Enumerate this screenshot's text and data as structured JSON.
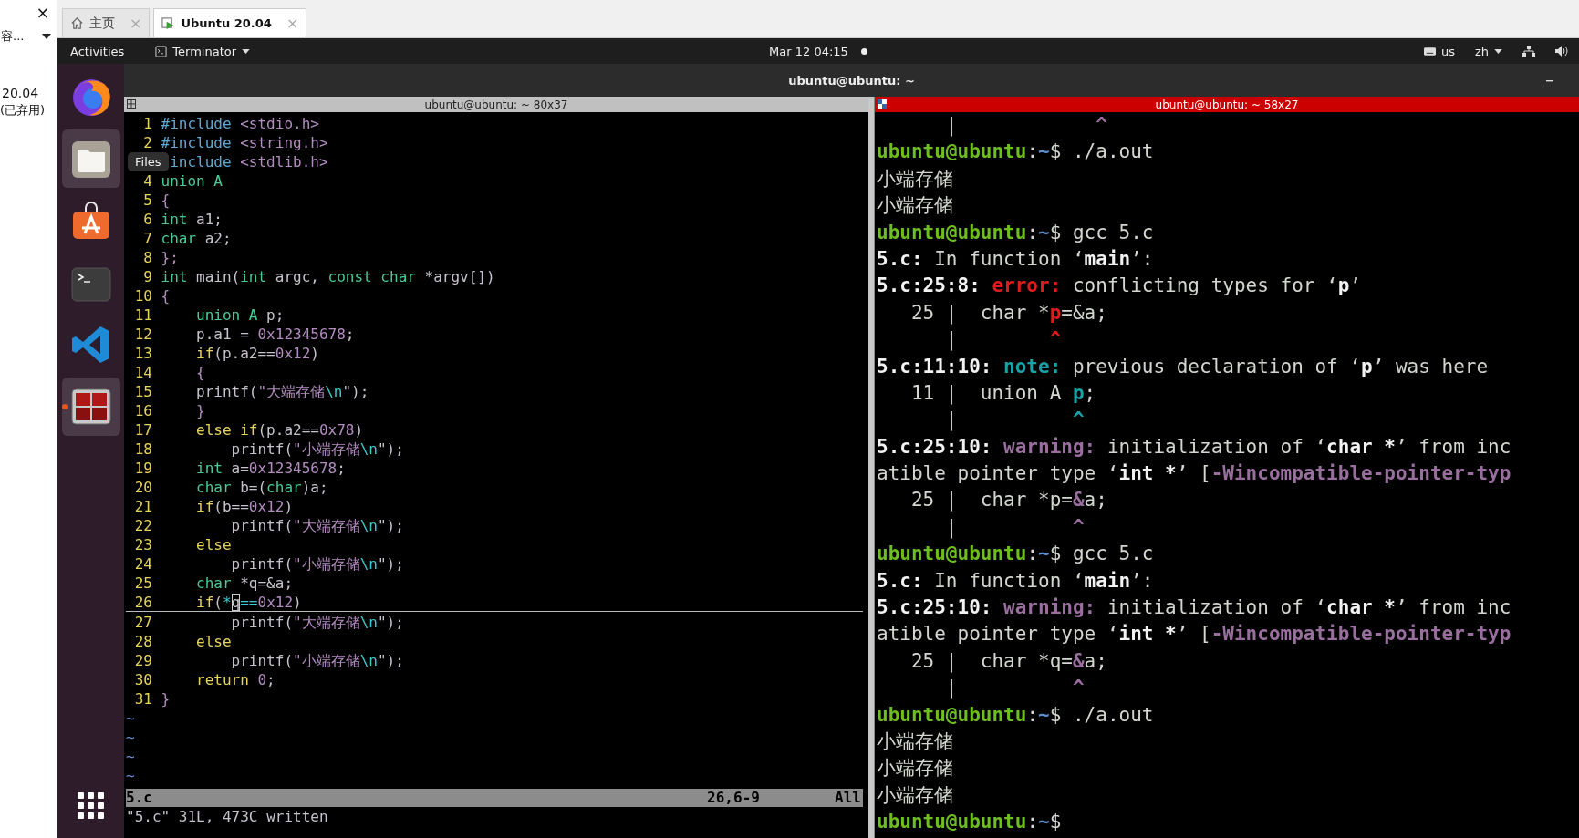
{
  "host": {
    "close": "×",
    "dropdown": "容...",
    "vm_version": "20.04",
    "vm_note": "(已弃用)",
    "tabs": [
      {
        "label": "主页",
        "kind": "home",
        "selected": false,
        "close": "×"
      },
      {
        "label": "Ubuntu 20.04",
        "kind": "vm",
        "selected": true,
        "close": "×"
      }
    ]
  },
  "topbar": {
    "activities": "Activities",
    "app_menu": "Terminator",
    "clock": "Mar 12 04:15",
    "keyboard": "us",
    "input_method": "zh"
  },
  "dock": {
    "tooltip": "Files",
    "items": [
      {
        "kind": "browser",
        "highlighted": false,
        "running": false
      },
      {
        "kind": "files",
        "highlighted": true,
        "running": false
      },
      {
        "kind": "software",
        "highlighted": false,
        "running": false
      },
      {
        "kind": "terminal",
        "highlighted": false,
        "running": false
      },
      {
        "kind": "editor",
        "highlighted": false,
        "running": false
      },
      {
        "kind": "terminator",
        "highlighted": true,
        "running": true
      }
    ]
  },
  "window": {
    "title": "ubuntu@ubuntu: ~"
  },
  "panes": [
    {
      "title": "ubuntu@ubuntu: ~ 80x37",
      "focused": false
    },
    {
      "title": "ubuntu@ubuntu: ~ 58x27",
      "focused": true
    }
  ],
  "vim": {
    "lines": [
      {
        "num": "1",
        "current": false,
        "segs": [
          {
            "text": "#include",
            "kind": "pre"
          },
          {
            "text": " <stdio.h>",
            "kind": "const"
          }
        ]
      },
      {
        "num": "2",
        "current": false,
        "segs": [
          {
            "text": "#include",
            "kind": "pre"
          },
          {
            "text": " <string.h>",
            "kind": "const"
          }
        ]
      },
      {
        "current": false,
        "segs": [
          {
            "text": "include",
            "kind": "pre"
          },
          {
            "text": " <stdlib.h>",
            "kind": "const"
          }
        ]
      },
      {
        "num": "4",
        "current": false,
        "segs": [
          {
            "text": "union A",
            "kind": "type"
          }
        ]
      },
      {
        "num": "5",
        "current": false,
        "segs": [
          {
            "text": "{",
            "kind": "const"
          }
        ]
      },
      {
        "num": "6",
        "current": false,
        "segs": [
          {
            "text": "int",
            "kind": "type"
          },
          {
            "text": " a1;",
            "kind": "plain"
          }
        ]
      },
      {
        "num": "7",
        "current": false,
        "segs": [
          {
            "text": "char",
            "kind": "type"
          },
          {
            "text": " a2;",
            "kind": "plain"
          }
        ]
      },
      {
        "num": "8",
        "current": false,
        "segs": [
          {
            "text": "};",
            "kind": "const"
          }
        ]
      },
      {
        "num": "9",
        "current": false,
        "segs": [
          {
            "text": "int",
            "kind": "type"
          },
          {
            "text": " main(",
            "kind": "plain"
          },
          {
            "text": "int",
            "kind": "type"
          },
          {
            "text": " argc, ",
            "kind": "plain"
          },
          {
            "text": "const",
            "kind": "type"
          },
          {
            "text": " char",
            "kind": "type"
          },
          {
            "text": " *argv[])",
            "kind": "plain"
          }
        ]
      },
      {
        "num": "10",
        "current": false,
        "segs": [
          {
            "text": "{",
            "kind": "const"
          }
        ]
      },
      {
        "num": "11",
        "current": false,
        "segs": [
          {
            "text": "    union A",
            "kind": "type"
          },
          {
            "text": " p;",
            "kind": "plain"
          }
        ]
      },
      {
        "num": "12",
        "current": false,
        "segs": [
          {
            "text": "    p.a1 = ",
            "kind": "plain"
          },
          {
            "text": "0x12345678",
            "kind": "const"
          },
          {
            "text": ";",
            "kind": "plain"
          }
        ]
      },
      {
        "num": "13",
        "current": false,
        "segs": [
          {
            "text": "    if",
            "kind": "stmt"
          },
          {
            "text": "(p.a2==",
            "kind": "plain"
          },
          {
            "text": "0x12",
            "kind": "const"
          },
          {
            "text": ")",
            "kind": "plain"
          }
        ]
      },
      {
        "num": "14",
        "current": false,
        "segs": [
          {
            "text": "    {",
            "kind": "const"
          }
        ]
      },
      {
        "num": "15",
        "current": false,
        "segs": [
          {
            "text": "    printf(",
            "kind": "plain"
          },
          {
            "text": "\"大端存储",
            "kind": "const"
          },
          {
            "text": "\\n",
            "kind": "special"
          },
          {
            "text": "\");",
            "kind": "plain"
          }
        ]
      },
      {
        "num": "16",
        "current": false,
        "segs": [
          {
            "text": "    }",
            "kind": "const"
          }
        ]
      },
      {
        "num": "17",
        "current": false,
        "segs": [
          {
            "text": "    else if",
            "kind": "stmt"
          },
          {
            "text": "(p.a2==",
            "kind": "plain"
          },
          {
            "text": "0x78",
            "kind": "const"
          },
          {
            "text": ")",
            "kind": "plain"
          }
        ]
      },
      {
        "num": "18",
        "current": false,
        "segs": [
          {
            "text": "        printf(",
            "kind": "plain"
          },
          {
            "text": "\"小端存储",
            "kind": "const"
          },
          {
            "text": "\\n",
            "kind": "special"
          },
          {
            "text": "\");",
            "kind": "plain"
          }
        ]
      },
      {
        "num": "19",
        "current": false,
        "segs": [
          {
            "text": "    int",
            "kind": "type"
          },
          {
            "text": " a=",
            "kind": "plain"
          },
          {
            "text": "0x12345678",
            "kind": "const"
          },
          {
            "text": ";",
            "kind": "plain"
          }
        ]
      },
      {
        "num": "20",
        "current": false,
        "segs": [
          {
            "text": "    char",
            "kind": "type"
          },
          {
            "text": " b=(",
            "kind": "plain"
          },
          {
            "text": "char",
            "kind": "type"
          },
          {
            "text": ")a;",
            "kind": "plain"
          }
        ]
      },
      {
        "num": "21",
        "current": false,
        "segs": [
          {
            "text": "    if",
            "kind": "stmt"
          },
          {
            "text": "(b==",
            "kind": "plain"
          },
          {
            "text": "0x12",
            "kind": "const"
          },
          {
            "text": ")",
            "kind": "plain"
          }
        ]
      },
      {
        "num": "22",
        "current": false,
        "segs": [
          {
            "text": "        printf(",
            "kind": "plain"
          },
          {
            "text": "\"大端存储",
            "kind": "const"
          },
          {
            "text": "\\n",
            "kind": "special"
          },
          {
            "text": "\");",
            "kind": "plain"
          }
        ]
      },
      {
        "num": "23",
        "current": false,
        "segs": [
          {
            "text": "    else",
            "kind": "stmt"
          }
        ]
      },
      {
        "num": "24",
        "current": false,
        "segs": [
          {
            "text": "        printf(",
            "kind": "plain"
          },
          {
            "text": "\"小端存储",
            "kind": "const"
          },
          {
            "text": "\\n",
            "kind": "special"
          },
          {
            "text": "\");",
            "kind": "plain"
          }
        ]
      },
      {
        "num": "25",
        "current": false,
        "segs": [
          {
            "text": "    char",
            "kind": "type"
          },
          {
            "text": " *q=&a;",
            "kind": "plain"
          }
        ]
      },
      {
        "num": "26",
        "current": true,
        "segs": [
          {
            "text": "    if",
            "kind": "stmt"
          },
          {
            "text": "(",
            "kind": "plain"
          },
          {
            "text": "*",
            "kind": "special"
          },
          {
            "text": "q",
            "kind": "cursor"
          },
          {
            "text": "==",
            "kind": "special"
          },
          {
            "text": "0x12",
            "kind": "const"
          },
          {
            "text": ")",
            "kind": "plain"
          }
        ]
      },
      {
        "num": "27",
        "current": false,
        "segs": [
          {
            "text": "        printf(",
            "kind": "plain"
          },
          {
            "text": "\"大端存储",
            "kind": "const"
          },
          {
            "text": "\\n",
            "kind": "special"
          },
          {
            "text": "\");",
            "kind": "plain"
          }
        ]
      },
      {
        "num": "28",
        "current": false,
        "segs": [
          {
            "text": "    else",
            "kind": "stmt"
          }
        ]
      },
      {
        "num": "29",
        "current": false,
        "segs": [
          {
            "text": "        printf(",
            "kind": "plain"
          },
          {
            "text": "\"小端存储",
            "kind": "const"
          },
          {
            "text": "\\n",
            "kind": "special"
          },
          {
            "text": "\");",
            "kind": "plain"
          }
        ]
      },
      {
        "num": "30",
        "current": false,
        "segs": [
          {
            "text": "    return",
            "kind": "stmt"
          },
          {
            "text": " 0",
            "kind": "const"
          },
          {
            "text": ";",
            "kind": "plain"
          }
        ]
      },
      {
        "num": "31",
        "current": false,
        "segs": [
          {
            "text": "}",
            "kind": "const"
          }
        ]
      }
    ],
    "filler": [
      "~",
      "~",
      "~",
      "~"
    ],
    "status": {
      "file": "5.c",
      "position": "26,6-9",
      "scroll": "All"
    },
    "message": "\"5.c\" 31L, 473C written"
  },
  "terminal": {
    "lines": [
      {
        "segs": [
          {
            "text": "      |            ",
            "kind": "plain"
          },
          {
            "text": "^",
            "kind": "purple"
          }
        ]
      },
      {
        "segs": [
          {
            "text": "ubuntu@ubuntu",
            "kind": "user"
          },
          {
            "text": ":",
            "kind": "plain"
          },
          {
            "text": "~",
            "kind": "path"
          },
          {
            "text": "$ ./a.out",
            "kind": "plain"
          }
        ]
      },
      {
        "segs": [
          {
            "text": "小端存储",
            "kind": "plain"
          }
        ]
      },
      {
        "segs": [
          {
            "text": "小端存储",
            "kind": "plain"
          }
        ]
      },
      {
        "segs": [
          {
            "text": "ubuntu@ubuntu",
            "kind": "user"
          },
          {
            "text": ":",
            "kind": "plain"
          },
          {
            "text": "~",
            "kind": "path"
          },
          {
            "text": "$ gcc 5.c",
            "kind": "plain"
          }
        ]
      },
      {
        "segs": [
          {
            "text": "5.c:",
            "kind": "bold"
          },
          {
            "text": " In function ‘",
            "kind": "plain"
          },
          {
            "text": "main",
            "kind": "bold"
          },
          {
            "text": "’:",
            "kind": "plain"
          }
        ]
      },
      {
        "segs": [
          {
            "text": "5.c:25:8: ",
            "kind": "bold"
          },
          {
            "text": "error:",
            "kind": "red"
          },
          {
            "text": " conflicting types for ‘",
            "kind": "plain"
          },
          {
            "text": "p",
            "kind": "bold"
          },
          {
            "text": "’",
            "kind": "plain"
          }
        ]
      },
      {
        "segs": [
          {
            "text": "   25 |  char *",
            "kind": "plain"
          },
          {
            "text": "p",
            "kind": "red"
          },
          {
            "text": "=&a;",
            "kind": "plain"
          }
        ]
      },
      {
        "segs": [
          {
            "text": "      |        ",
            "kind": "plain"
          },
          {
            "text": "^",
            "kind": "red"
          }
        ]
      },
      {
        "segs": [
          {
            "text": "5.c:11:10: ",
            "kind": "bold"
          },
          {
            "text": "note:",
            "kind": "cyan"
          },
          {
            "text": " previous declaration of ‘",
            "kind": "plain"
          },
          {
            "text": "p",
            "kind": "bold"
          },
          {
            "text": "’ was here",
            "kind": "plain"
          }
        ]
      },
      {
        "segs": [
          {
            "text": "   11 |  union A ",
            "kind": "plain"
          },
          {
            "text": "p",
            "kind": "cyan"
          },
          {
            "text": ";",
            "kind": "plain"
          }
        ]
      },
      {
        "segs": [
          {
            "text": "      |          ",
            "kind": "plain"
          },
          {
            "text": "^",
            "kind": "cyan"
          }
        ]
      },
      {
        "segs": [
          {
            "text": "5.c:25:10: ",
            "kind": "bold"
          },
          {
            "text": "warning:",
            "kind": "purple"
          },
          {
            "text": " initialization of ‘",
            "kind": "plain"
          },
          {
            "text": "char *",
            "kind": "bold"
          },
          {
            "text": "’ from inc",
            "kind": "plain"
          }
        ]
      },
      {
        "segs": [
          {
            "text": "atible pointer type ‘",
            "kind": "plain"
          },
          {
            "text": "int *",
            "kind": "bold"
          },
          {
            "text": "’ [",
            "kind": "plain"
          },
          {
            "text": "-Wincompatible-pointer-typ",
            "kind": "purple"
          }
        ]
      },
      {
        "segs": [
          {
            "text": "   25 |  char *p=",
            "kind": "plain"
          },
          {
            "text": "&",
            "kind": "purple"
          },
          {
            "text": "a;",
            "kind": "plain"
          }
        ]
      },
      {
        "segs": [
          {
            "text": "      |          ",
            "kind": "plain"
          },
          {
            "text": "^",
            "kind": "purple"
          }
        ]
      },
      {
        "segs": [
          {
            "text": "ubuntu@ubuntu",
            "kind": "user"
          },
          {
            "text": ":",
            "kind": "plain"
          },
          {
            "text": "~",
            "kind": "path"
          },
          {
            "text": "$ gcc 5.c",
            "kind": "plain"
          }
        ]
      },
      {
        "segs": [
          {
            "text": "5.c:",
            "kind": "bold"
          },
          {
            "text": " In function ‘",
            "kind": "plain"
          },
          {
            "text": "main",
            "kind": "bold"
          },
          {
            "text": "’:",
            "kind": "plain"
          }
        ]
      },
      {
        "segs": [
          {
            "text": "5.c:25:10: ",
            "kind": "bold"
          },
          {
            "text": "warning:",
            "kind": "purple"
          },
          {
            "text": " initialization of ‘",
            "kind": "plain"
          },
          {
            "text": "char *",
            "kind": "bold"
          },
          {
            "text": "’ from inc",
            "kind": "plain"
          }
        ]
      },
      {
        "segs": [
          {
            "text": "atible pointer type ‘",
            "kind": "plain"
          },
          {
            "text": "int *",
            "kind": "bold"
          },
          {
            "text": "’ [",
            "kind": "plain"
          },
          {
            "text": "-Wincompatible-pointer-typ",
            "kind": "purple"
          }
        ]
      },
      {
        "segs": [
          {
            "text": "   25 |  char *q=",
            "kind": "plain"
          },
          {
            "text": "&",
            "kind": "purple"
          },
          {
            "text": "a;",
            "kind": "plain"
          }
        ]
      },
      {
        "segs": [
          {
            "text": "      |          ",
            "kind": "plain"
          },
          {
            "text": "^",
            "kind": "purple"
          }
        ]
      },
      {
        "segs": [
          {
            "text": "ubuntu@ubuntu",
            "kind": "user"
          },
          {
            "text": ":",
            "kind": "plain"
          },
          {
            "text": "~",
            "kind": "path"
          },
          {
            "text": "$ ./a.out",
            "kind": "plain"
          }
        ]
      },
      {
        "segs": [
          {
            "text": "小端存储",
            "kind": "plain"
          }
        ]
      },
      {
        "segs": [
          {
            "text": "小端存储",
            "kind": "plain"
          }
        ]
      },
      {
        "segs": [
          {
            "text": "小端存储",
            "kind": "plain"
          }
        ]
      },
      {
        "segs": [
          {
            "text": "ubuntu@ubuntu",
            "kind": "user"
          },
          {
            "text": ":",
            "kind": "plain"
          },
          {
            "text": "~",
            "kind": "path"
          },
          {
            "text": "$",
            "kind": "plain"
          }
        ]
      }
    ]
  }
}
